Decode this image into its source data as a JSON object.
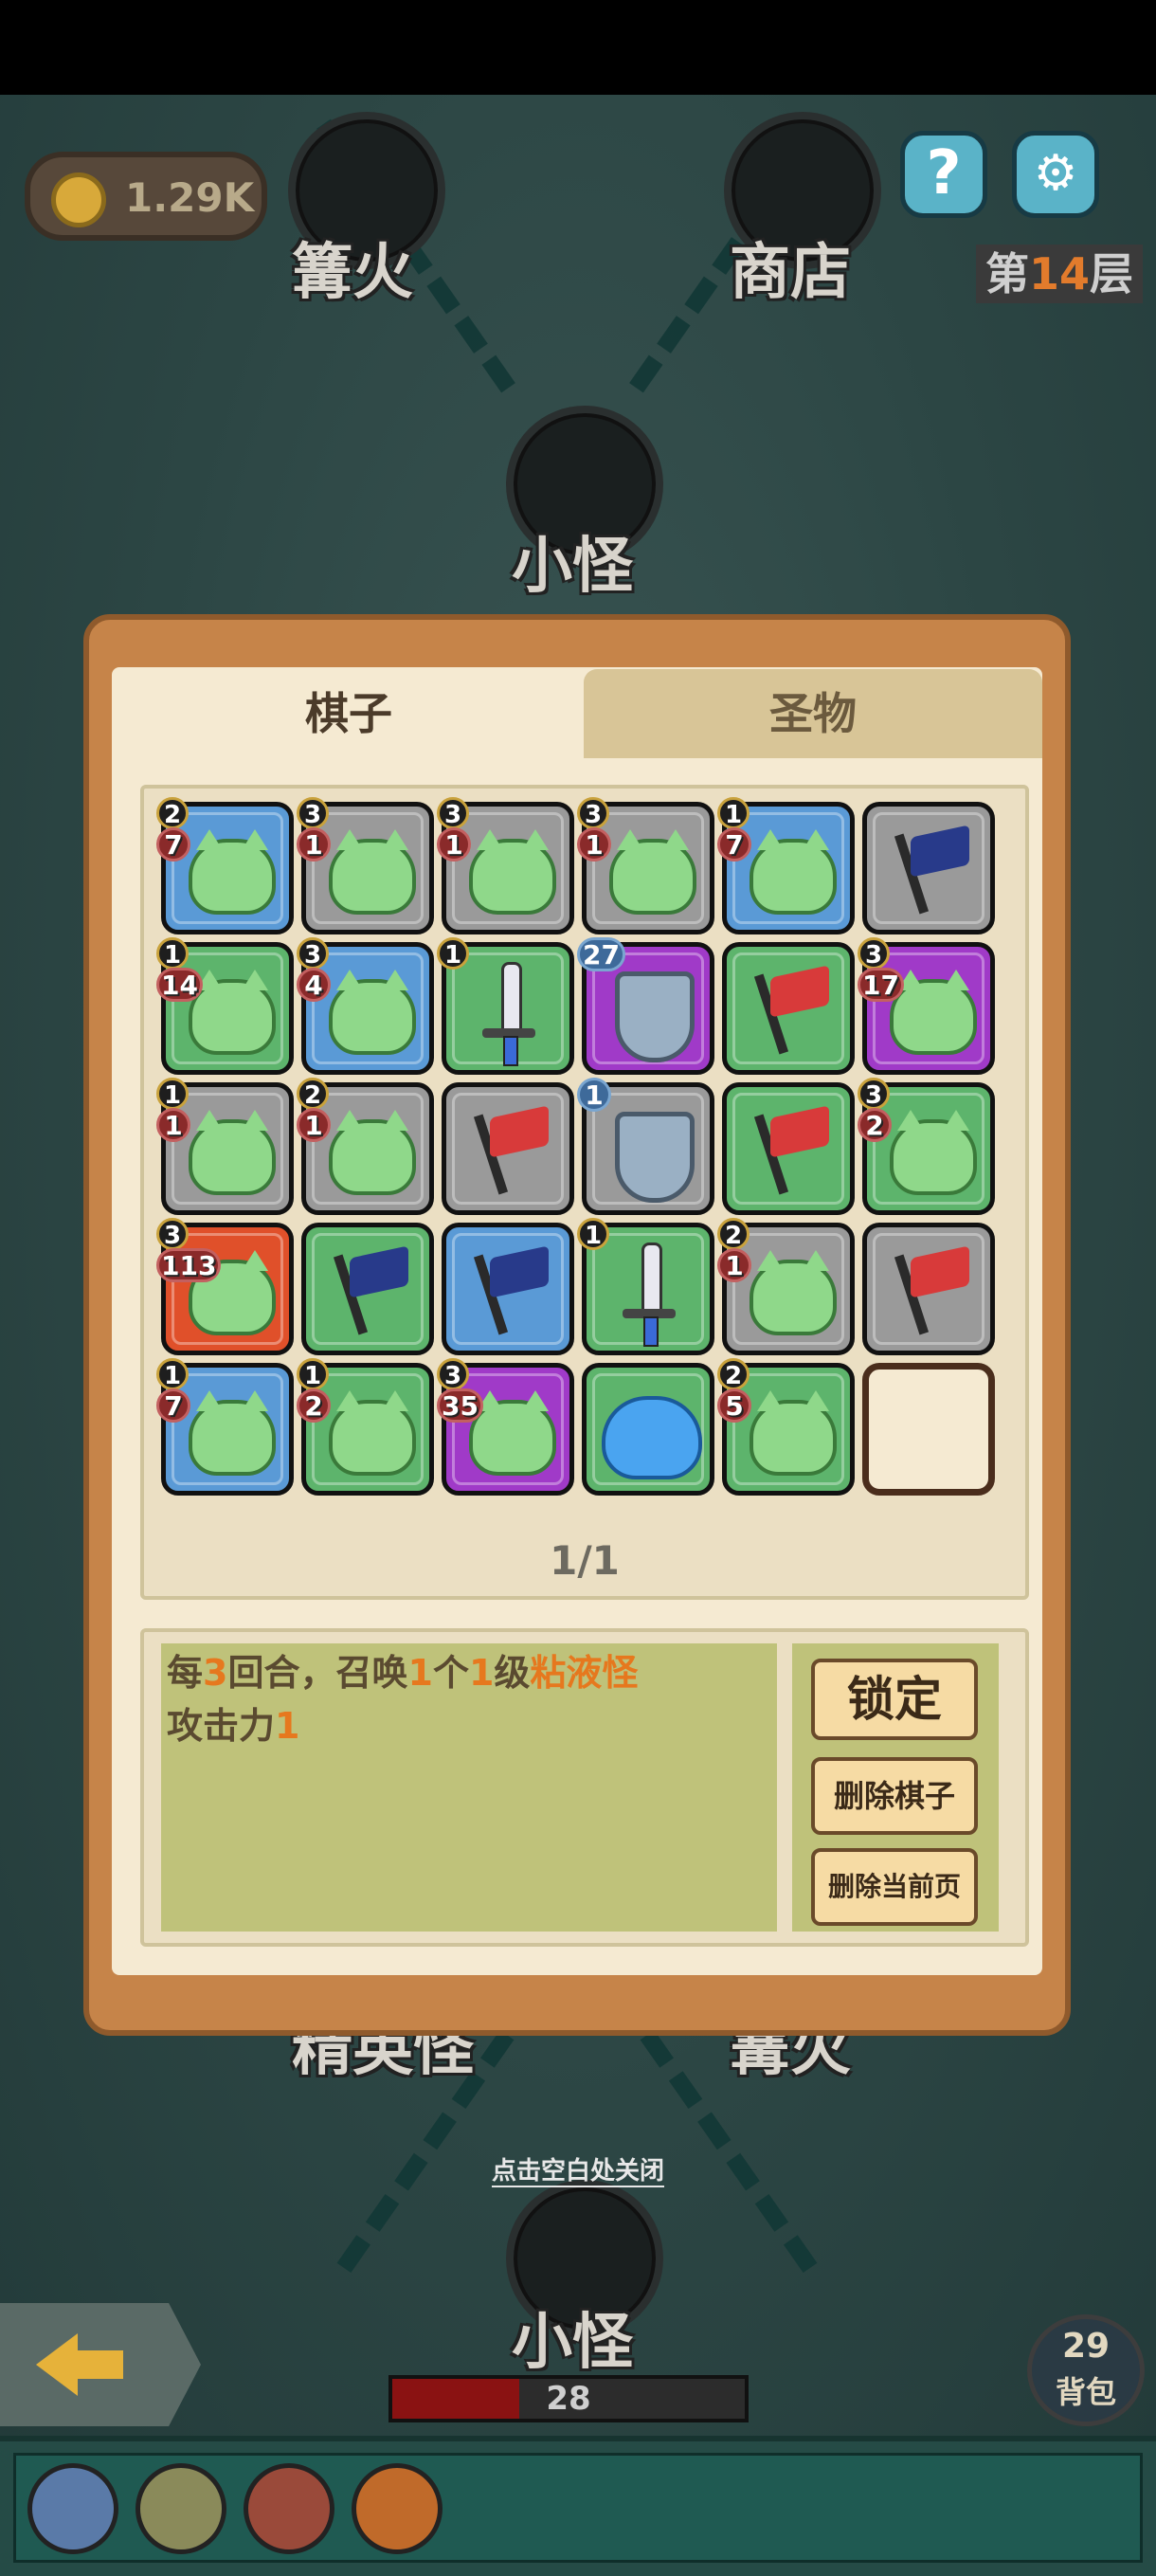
{
  "hud": {
    "gold": "1.29K",
    "help_label": "?",
    "floor_prefix": "第",
    "floor_number": "14",
    "floor_suffix": "层"
  },
  "map": {
    "nodes": [
      {
        "label": "篝火"
      },
      {
        "label": "商店"
      },
      {
        "label": "小怪"
      },
      {
        "label": "精英怪"
      },
      {
        "label": "篝火"
      },
      {
        "label": "小怪"
      }
    ]
  },
  "dialog": {
    "tabs": [
      "棋子",
      "圣物"
    ],
    "active_tab": "棋子",
    "pager": "1/1",
    "grid": [
      {
        "type": "slime",
        "bg": "blue",
        "top": "2",
        "bottom": "7"
      },
      {
        "type": "slime",
        "bg": "gray",
        "top": "3",
        "bottom": "1"
      },
      {
        "type": "slime",
        "bg": "gray",
        "top": "3",
        "bottom": "1"
      },
      {
        "type": "slime",
        "bg": "gray",
        "top": "3",
        "bottom": "1"
      },
      {
        "type": "slime",
        "bg": "blue",
        "top": "1",
        "bottom": "7"
      },
      {
        "type": "flag-navy",
        "bg": "gray"
      },
      {
        "type": "slime",
        "bg": "green",
        "top": "1",
        "bottom": "14"
      },
      {
        "type": "slime",
        "bg": "blue",
        "top": "3",
        "bottom": "4"
      },
      {
        "type": "sword",
        "bg": "green",
        "top": "1"
      },
      {
        "type": "shield",
        "bg": "purple",
        "blue": "27"
      },
      {
        "type": "flag-red",
        "bg": "green"
      },
      {
        "type": "slime",
        "bg": "purple",
        "top": "3",
        "bottom": "17"
      },
      {
        "type": "slime",
        "bg": "gray",
        "top": "1",
        "bottom": "1"
      },
      {
        "type": "slime",
        "bg": "gray",
        "top": "2",
        "bottom": "1"
      },
      {
        "type": "flag-red",
        "bg": "gray"
      },
      {
        "type": "shield",
        "bg": "gray",
        "blue": "1"
      },
      {
        "type": "flag-red",
        "bg": "green"
      },
      {
        "type": "slime",
        "bg": "green",
        "top": "3",
        "bottom": "2"
      },
      {
        "type": "slime",
        "bg": "red",
        "top": "3",
        "bottom": "113"
      },
      {
        "type": "flag-navy",
        "bg": "green"
      },
      {
        "type": "flag-navy",
        "bg": "blue"
      },
      {
        "type": "sword",
        "bg": "green",
        "top": "1"
      },
      {
        "type": "slime",
        "bg": "gray",
        "top": "2",
        "bottom": "1"
      },
      {
        "type": "flag-red",
        "bg": "gray"
      },
      {
        "type": "slime",
        "bg": "blue",
        "top": "1",
        "bottom": "7"
      },
      {
        "type": "slime",
        "bg": "green",
        "top": "1",
        "bottom": "2"
      },
      {
        "type": "slime",
        "bg": "purple",
        "top": "3",
        "bottom": "35"
      },
      {
        "type": "blob",
        "bg": "green"
      },
      {
        "type": "slime",
        "bg": "green",
        "top": "2",
        "bottom": "5"
      },
      {
        "type": "empty",
        "bg": "empty"
      }
    ],
    "description": {
      "line1": [
        "每",
        "3",
        "回合，召唤",
        "1",
        "个",
        "1",
        "级",
        "粘液怪"
      ],
      "line2": [
        "攻击力",
        "1"
      ]
    },
    "buttons": {
      "lock": "锁定",
      "delete_piece": "删除棋子",
      "delete_page": "删除当前页"
    }
  },
  "close_hint": "点击空白处关闭",
  "hp": {
    "value": "28",
    "fill_fraction": 0.36
  },
  "backpack": {
    "count": "29",
    "label": "背包"
  },
  "relics": [
    {
      "icon": "feather-sword-relic-icon"
    },
    {
      "icon": "rain-cloud-relic-icon"
    },
    {
      "icon": "red-beast-relic-icon"
    },
    {
      "icon": "fire-totem-relic-icon"
    }
  ],
  "colors": {
    "accent_orange": "#e6781e",
    "dialog_frame": "#c68449",
    "dialog_bg": "#f5ead2"
  }
}
